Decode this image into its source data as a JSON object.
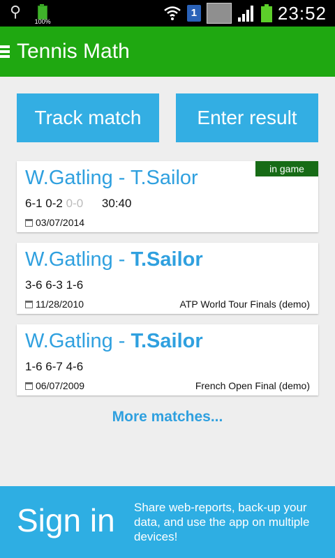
{
  "status_bar": {
    "battery_small_percent": "100%",
    "sim_number": "1",
    "time": "23:52",
    "icons": [
      "usb-icon",
      "battery-icon",
      "wifi-icon",
      "sim-icon",
      "signal-icon",
      "battery-icon"
    ]
  },
  "action_bar": {
    "title": "Tennis Math",
    "menu_icon": "hamburger-icon"
  },
  "buttons": {
    "track_label": "Track match",
    "enter_label": "Enter result"
  },
  "matches": [
    {
      "player1": "W.Gatling",
      "separator": " - ",
      "player2": "T.Sailor",
      "score_main": "6-1 0-2",
      "score_dim": "0-0",
      "time": "30:40",
      "date": "03/07/2014",
      "tournament": "",
      "badge": "in game"
    },
    {
      "player1": "W.Gatling",
      "separator": " - ",
      "player2": "T.Sailor",
      "score_main": "3-6 6-3 1-6",
      "date": "11/28/2010",
      "tournament": "ATP World Tour Finals (demo)"
    },
    {
      "player1": "W.Gatling",
      "separator": " - ",
      "player2": "T.Sailor",
      "score_main": "1-6 6-7 4-6",
      "date": "06/07/2009",
      "tournament": "French Open Final (demo)"
    }
  ],
  "more_label": "More matches...",
  "signin": {
    "title": "Sign in",
    "text": "Share web-reports, back-up your data, and use the app on multiple devices!"
  },
  "colors": {
    "action_bar": "#1fa811",
    "accent_blue": "#33aee3",
    "link_blue": "#2fa0df",
    "badge_green": "#176b16"
  }
}
